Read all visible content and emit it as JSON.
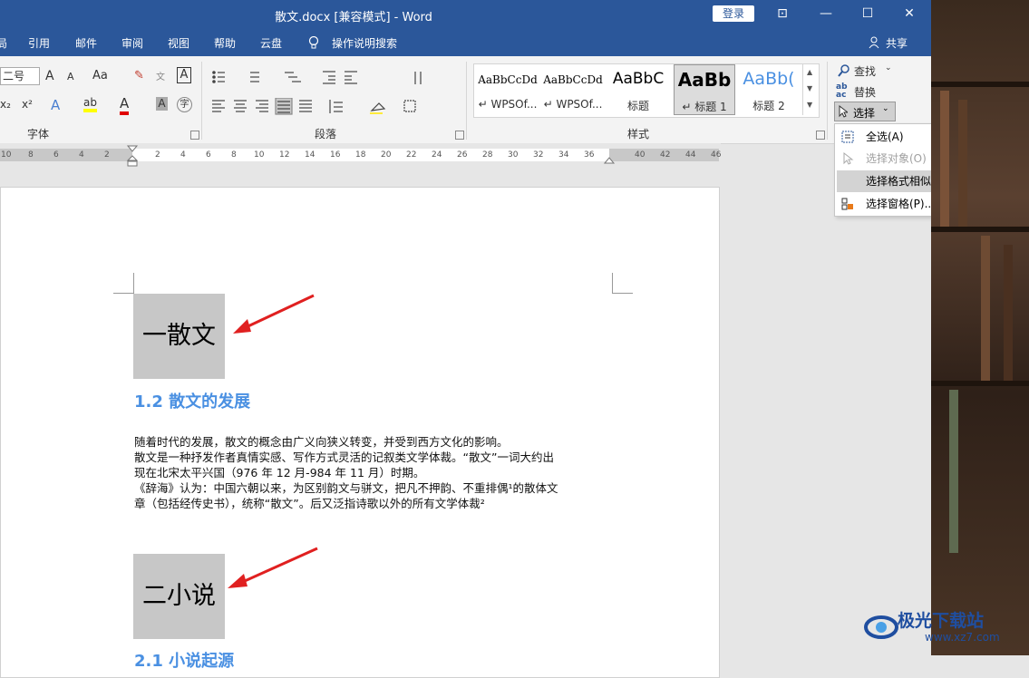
{
  "titlebar": {
    "title": "散文.docx [兼容模式]  -  Word",
    "login": "登录",
    "restore_glyph": "⊡",
    "minimize_glyph": "—",
    "maximize_glyph": "☐",
    "close_glyph": "✕"
  },
  "menu": {
    "items": [
      "引用",
      "邮件",
      "审阅",
      "视图",
      "帮助",
      "云盘"
    ],
    "tell_me": "操作说明搜索",
    "share": "共享",
    "partial_left": "局"
  },
  "ribbon": {
    "font_group_label": "字体",
    "paragraph_group_label": "段落",
    "styles_group_label": "样式",
    "font_size": "二号",
    "font_buttons": {
      "grow": "A",
      "shrink": "A",
      "case": "Aa",
      "subscript": "x₂",
      "superscript": "x²",
      "text_effect": "A",
      "highlight": "ab",
      "font_color": "A",
      "char_shade": "A",
      "enclose": "字",
      "phonetic": "文",
      "border_char": "A",
      "clear": "✎"
    },
    "styles": [
      {
        "sample": "AaBbCcDd",
        "name": "↵ WPSOf..."
      },
      {
        "sample": "AaBbCcDd",
        "name": "↵ WPSOf..."
      },
      {
        "sample": "AaBbC",
        "name": "标题"
      },
      {
        "sample": "AaBb",
        "name": "↵ 标题 1"
      },
      {
        "sample": "AaBb(",
        "name": "标题 2"
      }
    ],
    "editing": {
      "find": "查找",
      "replace": "替换",
      "select": "选择"
    }
  },
  "ruler": {
    "ticks": [
      "10",
      "8",
      "6",
      "4",
      "2",
      "2",
      "4",
      "6",
      "8",
      "10",
      "12",
      "14",
      "16",
      "18",
      "20",
      "22",
      "24",
      "26",
      "28",
      "30",
      "32",
      "34",
      "36",
      "40",
      "42",
      "44",
      "46"
    ]
  },
  "document": {
    "heading1": "一散文",
    "sub1": "1.2 散文的发展",
    "para_lines": [
      "随着时代的发展，散文的概念由广义向狭义转变，并受到西方文化的影响。",
      "散文是一种抒发作者真情实感、写作方式灵活的记叙类文学体裁。“散文”一词大约出",
      "现在北宋太平兴国（976 年 12 月-984 年 11 月）时期。",
      "《辞海》认为：中国六朝以来，为区别韵文与骈文，把凡不押韵、不重排偶¹的散体文",
      "章（包括经传史书），统称“散文”。后又泛指诗歌以外的所有文学体裁²"
    ],
    "heading2": "二小说",
    "sub2": "2.1 小说起源"
  },
  "dropdown": {
    "items": [
      {
        "label": "全选(A)",
        "disabled": false
      },
      {
        "label": "选择对象(O)",
        "disabled": true
      },
      {
        "label": "选择格式相似的文本(S)",
        "disabled": false,
        "highlighted": true
      },
      {
        "label": "选择窗格(P)...",
        "disabled": false
      }
    ]
  },
  "watermark": {
    "text": "极光下载站",
    "url": "www.xz7.com"
  },
  "colors": {
    "word_blue": "#2b579a",
    "heading_blue": "#4a90e2",
    "arrow_red": "#e02020",
    "highlight_gray": "#c7c7c7"
  }
}
